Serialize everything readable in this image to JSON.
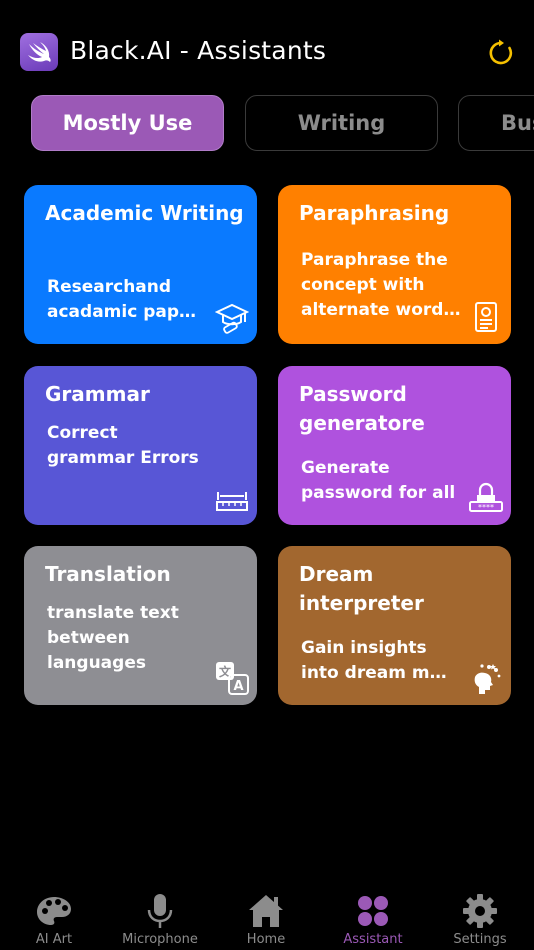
{
  "header": {
    "title": "Black.AI - Assistants",
    "logo_icon": "swift-bird-icon",
    "refresh_icon": "refresh-icon",
    "accent_color": "#f5c000"
  },
  "tabs": [
    {
      "label": "Mostly Use",
      "active": true
    },
    {
      "label": "Writing",
      "active": false
    },
    {
      "label": "Bus",
      "active": false
    }
  ],
  "cards": [
    {
      "title": "Academic Writing",
      "desc_line1": "Researchand",
      "desc_line2": "acadamic papers",
      "color": "#0a7aff",
      "icon": "graduation-cap-icon"
    },
    {
      "title": "Paraphrasing",
      "desc_line1": "Paraphrase the",
      "desc_line2": "concept with",
      "desc_line3": "alternate wording",
      "color": "#ff8000",
      "icon": "document-icon"
    },
    {
      "title": "Grammar",
      "desc_line1": "Correct",
      "desc_line2": "grammar Errors",
      "color": "#5856d6",
      "icon": "ruler-icon"
    },
    {
      "title": "Password generatore",
      "desc_line1": "Generate",
      "desc_line2": "password for all",
      "color": "#af52de",
      "icon": "lock-password-icon"
    },
    {
      "title": "Translation",
      "desc_line1": "translate text",
      "desc_line2": "between",
      "desc_line3": "languages",
      "color": "#8e8e93",
      "icon": "translate-icon"
    },
    {
      "title": "Dream interpreter",
      "desc_line1": "Gain insights",
      "desc_line2": "into dream meanings",
      "color": "#a2672f",
      "icon": "head-thoughts-icon"
    }
  ],
  "nav": [
    {
      "label": "AI Art",
      "icon": "palette-icon",
      "active": false
    },
    {
      "label": "Microphone",
      "icon": "microphone-icon",
      "active": false
    },
    {
      "label": "Home",
      "icon": "home-icon",
      "active": false
    },
    {
      "label": "Assistant",
      "icon": "four-dots-icon",
      "active": true
    },
    {
      "label": "Settings",
      "icon": "gear-icon",
      "active": false
    }
  ]
}
